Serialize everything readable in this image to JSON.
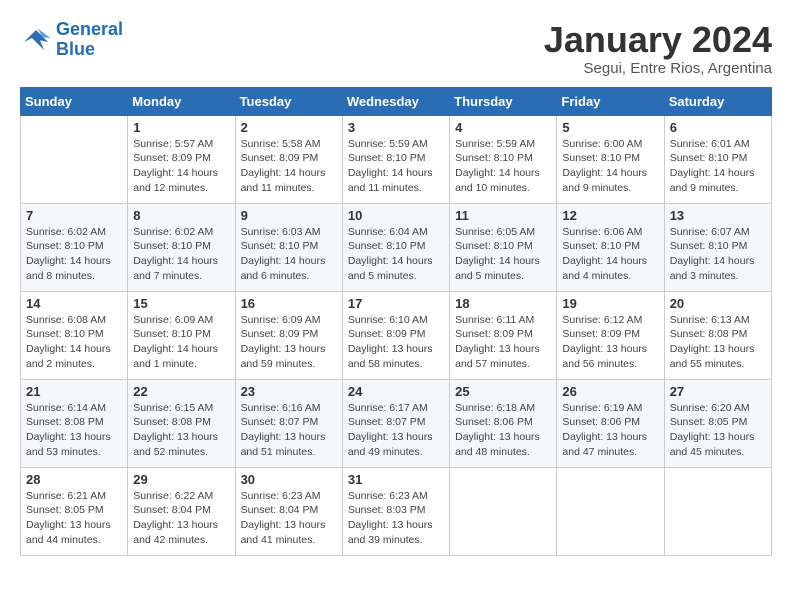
{
  "logo": {
    "line1": "General",
    "line2": "Blue"
  },
  "title": "January 2024",
  "subtitle": "Segui, Entre Rios, Argentina",
  "weekdays": [
    "Sunday",
    "Monday",
    "Tuesday",
    "Wednesday",
    "Thursday",
    "Friday",
    "Saturday"
  ],
  "weeks": [
    [
      {
        "day": "",
        "info": ""
      },
      {
        "day": "1",
        "info": "Sunrise: 5:57 AM\nSunset: 8:09 PM\nDaylight: 14 hours\nand 12 minutes."
      },
      {
        "day": "2",
        "info": "Sunrise: 5:58 AM\nSunset: 8:09 PM\nDaylight: 14 hours\nand 11 minutes."
      },
      {
        "day": "3",
        "info": "Sunrise: 5:59 AM\nSunset: 8:10 PM\nDaylight: 14 hours\nand 11 minutes."
      },
      {
        "day": "4",
        "info": "Sunrise: 5:59 AM\nSunset: 8:10 PM\nDaylight: 14 hours\nand 10 minutes."
      },
      {
        "day": "5",
        "info": "Sunrise: 6:00 AM\nSunset: 8:10 PM\nDaylight: 14 hours\nand 9 minutes."
      },
      {
        "day": "6",
        "info": "Sunrise: 6:01 AM\nSunset: 8:10 PM\nDaylight: 14 hours\nand 9 minutes."
      }
    ],
    [
      {
        "day": "7",
        "info": "Sunrise: 6:02 AM\nSunset: 8:10 PM\nDaylight: 14 hours\nand 8 minutes."
      },
      {
        "day": "8",
        "info": "Sunrise: 6:02 AM\nSunset: 8:10 PM\nDaylight: 14 hours\nand 7 minutes."
      },
      {
        "day": "9",
        "info": "Sunrise: 6:03 AM\nSunset: 8:10 PM\nDaylight: 14 hours\nand 6 minutes."
      },
      {
        "day": "10",
        "info": "Sunrise: 6:04 AM\nSunset: 8:10 PM\nDaylight: 14 hours\nand 5 minutes."
      },
      {
        "day": "11",
        "info": "Sunrise: 6:05 AM\nSunset: 8:10 PM\nDaylight: 14 hours\nand 5 minutes."
      },
      {
        "day": "12",
        "info": "Sunrise: 6:06 AM\nSunset: 8:10 PM\nDaylight: 14 hours\nand 4 minutes."
      },
      {
        "day": "13",
        "info": "Sunrise: 6:07 AM\nSunset: 8:10 PM\nDaylight: 14 hours\nand 3 minutes."
      }
    ],
    [
      {
        "day": "14",
        "info": "Sunrise: 6:08 AM\nSunset: 8:10 PM\nDaylight: 14 hours\nand 2 minutes."
      },
      {
        "day": "15",
        "info": "Sunrise: 6:09 AM\nSunset: 8:10 PM\nDaylight: 14 hours\nand 1 minute."
      },
      {
        "day": "16",
        "info": "Sunrise: 6:09 AM\nSunset: 8:09 PM\nDaylight: 13 hours\nand 59 minutes."
      },
      {
        "day": "17",
        "info": "Sunrise: 6:10 AM\nSunset: 8:09 PM\nDaylight: 13 hours\nand 58 minutes."
      },
      {
        "day": "18",
        "info": "Sunrise: 6:11 AM\nSunset: 8:09 PM\nDaylight: 13 hours\nand 57 minutes."
      },
      {
        "day": "19",
        "info": "Sunrise: 6:12 AM\nSunset: 8:09 PM\nDaylight: 13 hours\nand 56 minutes."
      },
      {
        "day": "20",
        "info": "Sunrise: 6:13 AM\nSunset: 8:08 PM\nDaylight: 13 hours\nand 55 minutes."
      }
    ],
    [
      {
        "day": "21",
        "info": "Sunrise: 6:14 AM\nSunset: 8:08 PM\nDaylight: 13 hours\nand 53 minutes."
      },
      {
        "day": "22",
        "info": "Sunrise: 6:15 AM\nSunset: 8:08 PM\nDaylight: 13 hours\nand 52 minutes."
      },
      {
        "day": "23",
        "info": "Sunrise: 6:16 AM\nSunset: 8:07 PM\nDaylight: 13 hours\nand 51 minutes."
      },
      {
        "day": "24",
        "info": "Sunrise: 6:17 AM\nSunset: 8:07 PM\nDaylight: 13 hours\nand 49 minutes."
      },
      {
        "day": "25",
        "info": "Sunrise: 6:18 AM\nSunset: 8:06 PM\nDaylight: 13 hours\nand 48 minutes."
      },
      {
        "day": "26",
        "info": "Sunrise: 6:19 AM\nSunset: 8:06 PM\nDaylight: 13 hours\nand 47 minutes."
      },
      {
        "day": "27",
        "info": "Sunrise: 6:20 AM\nSunset: 8:05 PM\nDaylight: 13 hours\nand 45 minutes."
      }
    ],
    [
      {
        "day": "28",
        "info": "Sunrise: 6:21 AM\nSunset: 8:05 PM\nDaylight: 13 hours\nand 44 minutes."
      },
      {
        "day": "29",
        "info": "Sunrise: 6:22 AM\nSunset: 8:04 PM\nDaylight: 13 hours\nand 42 minutes."
      },
      {
        "day": "30",
        "info": "Sunrise: 6:23 AM\nSunset: 8:04 PM\nDaylight: 13 hours\nand 41 minutes."
      },
      {
        "day": "31",
        "info": "Sunrise: 6:23 AM\nSunset: 8:03 PM\nDaylight: 13 hours\nand 39 minutes."
      },
      {
        "day": "",
        "info": ""
      },
      {
        "day": "",
        "info": ""
      },
      {
        "day": "",
        "info": ""
      }
    ]
  ]
}
